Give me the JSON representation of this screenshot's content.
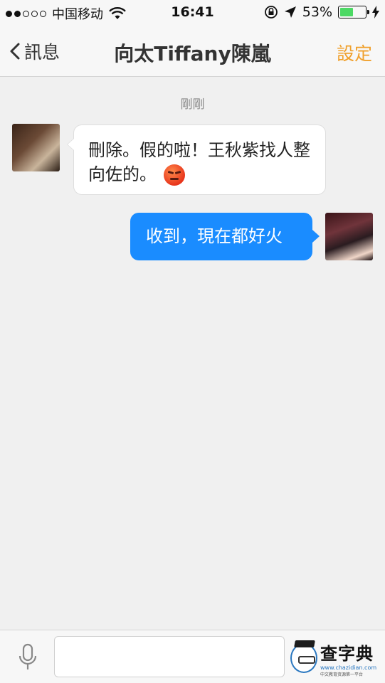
{
  "status_bar": {
    "carrier": "中国移动",
    "time": "16:41",
    "battery": "53%",
    "battery_level": 0.53,
    "signal_bars_filled": 2,
    "signal_bars_total": 5
  },
  "nav": {
    "back_label": "訊息",
    "title": "向太Tiffany陳嵐",
    "settings_label": "設定"
  },
  "chat": {
    "timestamp": "剛剛",
    "messages": [
      {
        "direction": "incoming",
        "text": "刪除。假的啦！王秋紫找人整向佐的。",
        "emoji": "angry-face-icon"
      },
      {
        "direction": "outgoing",
        "text": "收到，現在都好火"
      }
    ]
  },
  "input": {
    "value": "",
    "placeholder": ""
  },
  "watermark": {
    "title": "查字典",
    "url": "www.chazidian.com",
    "subtitle": "中文教育资源第一平台"
  },
  "colors": {
    "accent": "#f0a02c",
    "outgoing_bubble": "#1a8cff",
    "background": "#f0f0f0"
  }
}
